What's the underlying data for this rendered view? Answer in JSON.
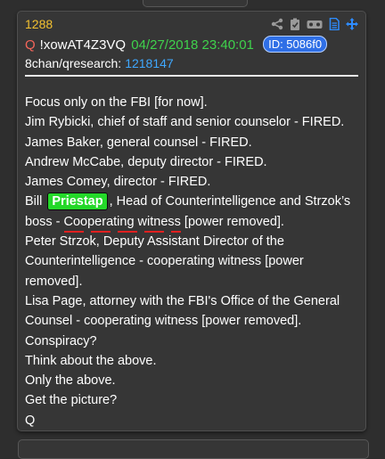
{
  "post": {
    "number": "1288",
    "q": "Q",
    "tripcode": "!xowAT4Z3VQ",
    "date": "04/27/2018 23:40:01",
    "id_badge": "ID: 5086f0",
    "board": "8chan/qresearch:",
    "board_ref": "1218147",
    "icons": [
      "share-icon",
      "clipboard-check-icon",
      "vr-headset-icon",
      "document-icon",
      "move-arrows-icon"
    ]
  },
  "body": {
    "lines": [
      "Focus only on the FBI [for now].",
      "Jim Rybicki, chief of staff and senior counselor - FIRED.",
      "James Baker, general counsel - FIRED.",
      "Andrew McCabe, deputy director - FIRED.",
      "James Comey, director - FIRED."
    ],
    "bill_prefix": "Bill ",
    "bill_highlight": "Priestap",
    "bill_suffix": ", Head of Counterintelligence and Strzok’s",
    "boss_prefix": "boss - ",
    "boss_underlined": "Cooperating witness",
    "boss_suffix": " [power removed].",
    "lines2": [
      "Peter Strzok, Deputy Assistant Director of the",
      "Counterintelligence - cooperating witness [power",
      "removed].",
      "Lisa Page, attorney with the FBI's Office of the General",
      "Counsel - cooperating witness [power removed].",
      "Conspiracy?",
      "Think about the above.",
      "Only the above.",
      "Get the picture?",
      "Q"
    ]
  },
  "colors": {
    "background": "#2e2e2e",
    "card": "#363636",
    "post_number": "#f3c130",
    "q_name": "#f4655a",
    "date": "#3fd24c",
    "id_badge": "#2f6fe6",
    "board_link": "#3fa8ff",
    "highlight": "#24d829",
    "underline": "#e02020"
  }
}
